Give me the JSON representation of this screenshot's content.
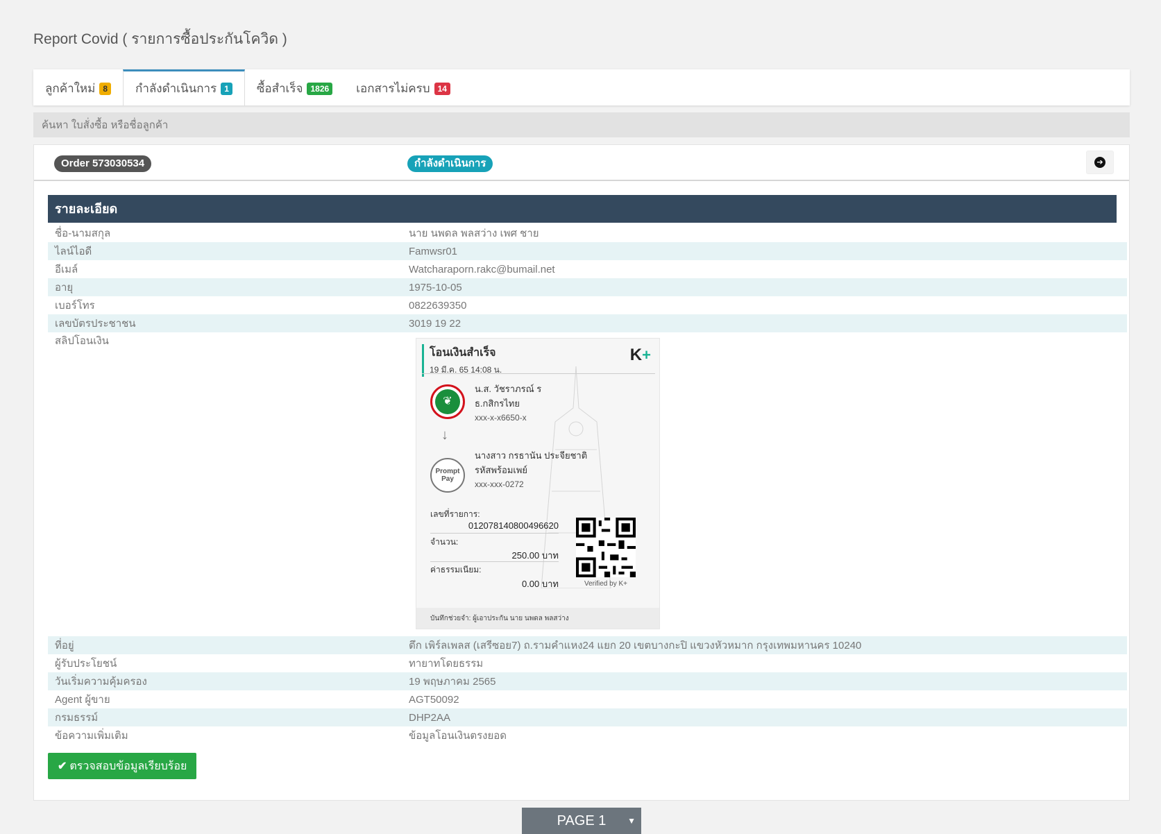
{
  "page_title": "Report Covid ( รายการซื้อประกันโควิด )",
  "tabs": [
    {
      "label": "ลูกค้าใหม่",
      "count": "8",
      "color": "#f0ad00"
    },
    {
      "label": "กำลังดำเนินการ",
      "count": "1",
      "color": "#17a2b8",
      "active": true
    },
    {
      "label": "ซื้อสำเร็จ",
      "count": "1826",
      "color": "#28a745"
    },
    {
      "label": "เอกสารไม่ครบ",
      "count": "14",
      "color": "#dc3545"
    }
  ],
  "search": {
    "placeholder": "ค้นหา ใบสั่งซื้อ หรือชื่อลูกค้า"
  },
  "order": {
    "label": "Order 573030534",
    "status": "กำลังดำเนินการ"
  },
  "details_header": "รายละเอียด",
  "details_top": [
    {
      "label": "ชื่อ-นามสกุล",
      "value": "นาย นพดล พลสว่าง เพศ ชาย"
    },
    {
      "label": "ไลน์ไอดี",
      "value": "Famwsr01"
    },
    {
      "label": "อีเมล์",
      "value": "Watcharaporn.rakc@bumail.net"
    },
    {
      "label": "อายุ",
      "value": "1975-10-05"
    },
    {
      "label": "เบอร์โทร",
      "value": "0822639350"
    },
    {
      "label": "เลขบัตรประชาชน",
      "value": "3019  19  22"
    }
  ],
  "slip_label": "สลิปโอนเงิน",
  "slip": {
    "title": "โอนเงินสำเร็จ",
    "datetime": "19 มี.ค. 65  14:08 น.",
    "brand": "K",
    "brand_plus": "+",
    "sender_name": "น.ส. วัชราภรณ์ ร",
    "sender_bank": "ธ.กสิกรไทย",
    "sender_account": "xxx-x-x6650-x",
    "receiver_name": "นางสาว กรธานัน ประจียชาติ",
    "receiver_type": "รหัสพร้อมเพย์",
    "receiver_account": "xxx-xxx-0272",
    "promptpay_line1": "Prompt",
    "promptpay_line2": "Pay",
    "txn_label": "เลขที่รายการ:",
    "txn_value": "012078140800496620",
    "amount_label": "จำนวน:",
    "amount_value": "250.00 บาท",
    "fee_label": "ค่าธรรมเนียม:",
    "fee_value": "0.00 บาท",
    "verified": "Verified by K+",
    "memo": "บันทึกช่วยจำ: ผู้เอาประกัน นาย นพดล พลสว่าง"
  },
  "details_bottom": [
    {
      "label": "ที่อยู่",
      "value": "ตึก เพิร์ลเพลส (เสรีซอย7) ถ.รามคำแหง24 แยก 20 เขตบางกะปิ แขวงหัวหมาก กรุงเทพมหานคร 10240"
    },
    {
      "label": "ผู้รับประโยชน์",
      "value": "ทายาทโดยธรรม"
    },
    {
      "label": "วันเริ่มความคุ้มครอง",
      "value": "19 พฤษภาคม 2565"
    },
    {
      "label": "Agent ผู้ขาย",
      "value": "AGT50092"
    },
    {
      "label": "กรมธรรม์",
      "value": "DHP2AA"
    },
    {
      "label": "ข้อความเพิ่มเติม",
      "value": "ข้อมูลโอนเงินตรงยอด"
    }
  ],
  "verify_button": "ตรวจสอบข้อมูลเรียบร้อย",
  "pagination": {
    "selected": "PAGE 1"
  }
}
